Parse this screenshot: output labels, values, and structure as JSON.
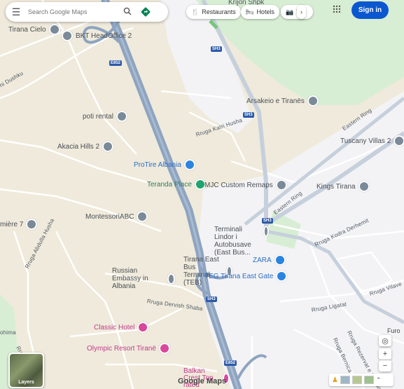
{
  "search": {
    "placeholder": "Search Google Maps"
  },
  "chips": [
    {
      "label": "Restaurants",
      "icon": "fork-knife-icon"
    },
    {
      "label": "Hotels",
      "icon": "bed-icon"
    },
    {
      "label": "T",
      "icon": "camera-icon"
    }
  ],
  "signin_label": "Sign in",
  "layers_label": "Layers",
  "logo_text": "Google Maps",
  "places": [
    {
      "name": "Krijon Shpk",
      "kind": "gray"
    },
    {
      "name": "Tirana Cielo",
      "kind": "gray"
    },
    {
      "name": "BKT HeadOffice 2",
      "kind": "gray"
    },
    {
      "name": "Arsakeio e Tiranës",
      "kind": "gray"
    },
    {
      "name": "poti rental",
      "kind": "gray"
    },
    {
      "name": "Tuscany Villas 2",
      "kind": "gray"
    },
    {
      "name": "Akacia Hills 2",
      "kind": "gray"
    },
    {
      "name": "ProTire Albania",
      "kind": "blue"
    },
    {
      "name": "Teranda Place",
      "kind": "green"
    },
    {
      "name": "MJC Custom Remaps",
      "kind": "gray"
    },
    {
      "name": "Kings Tirana",
      "kind": "gray"
    },
    {
      "name": "MontessoriABC",
      "kind": "gray"
    },
    {
      "name": "mière 7",
      "kind": "gray"
    },
    {
      "name": "Terminali Lindor i Autobusave (East Bus...",
      "kind": "gray"
    },
    {
      "name": "Tirana East Bus Terminal (TEB)",
      "kind": "gray"
    },
    {
      "name": "ZARA",
      "kind": "blue"
    },
    {
      "name": "Russian Embassy in Albania",
      "kind": "gray"
    },
    {
      "name": "TEG Tirana East Gate",
      "kind": "blue"
    },
    {
      "name": "Classic Hotel",
      "kind": "pink"
    },
    {
      "name": "Olympic Resort Tiranë",
      "kind": "pink"
    },
    {
      "name": "Balkan Crest Top rated",
      "kind": "pink"
    },
    {
      "name": "Furo",
      "kind": "gray"
    }
  ],
  "streets": [
    "hi Dushku",
    "Rruga Katri Husha",
    "Eastern Ring",
    "Eastern Ring",
    "Rruga Kodra Derhemit",
    "Rruga Abdulla Husha",
    "Rruga Dervish Shaba",
    "Rruga Ligatat",
    "Rruga Vilave",
    "Rruga Bernica",
    "Rruga Rezervat e Shtëpis",
    "ohima",
    "Rruga"
  ],
  "shields": [
    "E852",
    "SH3",
    "SH3",
    "SH3",
    "SH3",
    "SH3",
    "E852"
  ],
  "colors": {
    "land": "#efeadb",
    "highway": "#8ea4c0",
    "urban": "#f4f4f6",
    "park": "#d9eed5",
    "signin": "#0b57d0"
  }
}
